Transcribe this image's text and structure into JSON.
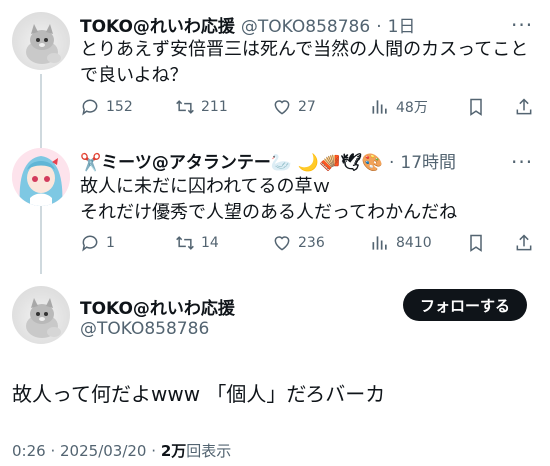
{
  "tweet1": {
    "author_name": "TOKO@れいわ応援",
    "author_handle": "@TOKO858786",
    "separator": "·",
    "time": "1日",
    "text_line1": "とりあえず安倍晋三は死んで当然の人間のカスってこと",
    "text_line2": "で良いよね？",
    "replies": "152",
    "retweets": "211",
    "likes": "27",
    "views": "48万"
  },
  "tweet2": {
    "author_name": "✂️ミーツ@アタランテー🦢 🌙🪗🕊🎨",
    "separator": "·",
    "time": "17時間",
    "text_line1": "故人に未だに囚われてるの草ｗ",
    "text_line2": "それだけ優秀で人望のある人だってわかんだね",
    "replies": "1",
    "retweets": "14",
    "likes": "236",
    "views": "8410"
  },
  "tweet3": {
    "author_name": "TOKO@れいわ応援",
    "author_handle": "@TOKO858786",
    "follow_label": "フォローする",
    "text": "故人って何だよwww 「個人」だろバーカ",
    "time": "0:26",
    "date": "2025/03/20",
    "views_count": "2万",
    "views_label": "回表示"
  },
  "icons": [
    "cat-avatar",
    "anime-avatar",
    "reply-icon",
    "retweet-icon",
    "like-icon",
    "views-icon",
    "bookmark-icon",
    "share-icon",
    "more-icon"
  ],
  "colors": {
    "text": "#0f1419",
    "secondary": "#536471",
    "thread_line": "#cfd9de",
    "button": "#0f1419"
  }
}
